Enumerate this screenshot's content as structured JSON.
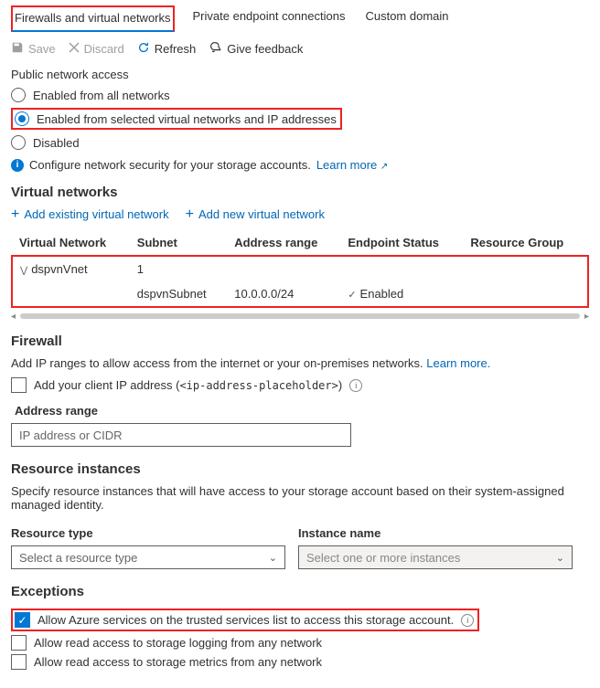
{
  "tabs": {
    "firewalls": "Firewalls and virtual networks",
    "endpoints": "Private endpoint connections",
    "custom": "Custom domain"
  },
  "toolbar": {
    "save": "Save",
    "discard": "Discard",
    "refresh": "Refresh",
    "feedback": "Give feedback"
  },
  "public_access": {
    "heading": "Public network access",
    "opt_all": "Enabled from all networks",
    "opt_selected": "Enabled from selected virtual networks and IP addresses",
    "opt_disabled": "Disabled"
  },
  "info": {
    "text": "Configure network security for your storage accounts.",
    "learn_more": "Learn more"
  },
  "vnet": {
    "heading": "Virtual networks",
    "add_existing": "Add existing virtual network",
    "add_new": "Add new virtual network",
    "cols": {
      "network": "Virtual Network",
      "subnet": "Subnet",
      "range": "Address range",
      "status": "Endpoint Status",
      "rg": "Resource Group"
    },
    "row1": {
      "name": "dspvnVnet",
      "subnet": "1"
    },
    "row2": {
      "subnet": "dspvnSubnet",
      "range": "10.0.0.0/24",
      "status": "Enabled"
    }
  },
  "firewall": {
    "heading": "Firewall",
    "desc_a": "Add IP ranges to allow access from the internet or your on-premises networks.",
    "learn_more": "Learn more.",
    "add_client_ip": "Add your client IP address (",
    "ip_placeholder": "<ip-address-placeholder>",
    "close_paren": ")",
    "addr_label": "Address range",
    "addr_placeholder": "IP address or CIDR"
  },
  "resources": {
    "heading": "Resource instances",
    "desc": "Specify resource instances that will have access to your storage account based on their system-assigned managed identity.",
    "type_label": "Resource type",
    "name_label": "Instance name",
    "type_placeholder": "Select a resource type",
    "name_placeholder": "Select one or more instances"
  },
  "exceptions": {
    "heading": "Exceptions",
    "trusted": "Allow Azure services on the trusted services list to access this storage account.",
    "logging": "Allow read access to storage logging from any network",
    "metrics": "Allow read access to storage metrics from any network"
  }
}
